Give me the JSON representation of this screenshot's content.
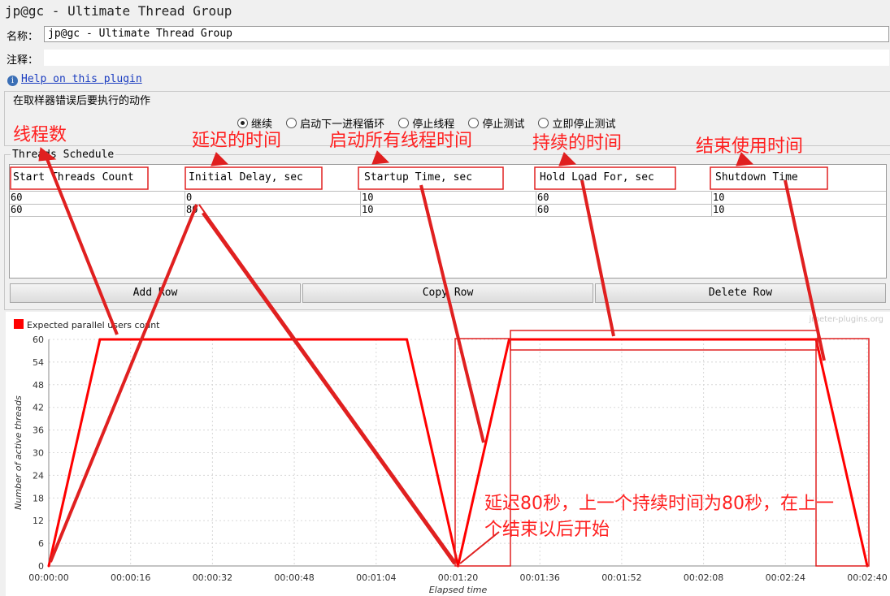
{
  "window": {
    "title": "jp@gc - Ultimate Thread Group"
  },
  "form": {
    "name_label": "名称：",
    "name_value": "jp@gc - Ultimate Thread Group",
    "comment_label": "注释：",
    "comment_value": "",
    "help_icon": "info-icon",
    "help_text": "Help on this plugin"
  },
  "error_action": {
    "title": "在取样器错误后要执行的动作",
    "options": [
      {
        "label": "继续",
        "selected": true
      },
      {
        "label": "启动下一进程循环",
        "selected": false
      },
      {
        "label": "停止线程",
        "selected": false
      },
      {
        "label": "停止测试",
        "selected": false
      },
      {
        "label": "立即停止测试",
        "selected": false
      }
    ]
  },
  "schedule": {
    "title": "Threads Schedule",
    "columns": [
      "Start Threads Count",
      "Initial Delay, sec",
      "Startup Time, sec",
      "Hold Load For, sec",
      "Shutdown Time"
    ],
    "rows": [
      [
        "60",
        "0",
        "10",
        "60",
        "10"
      ],
      [
        "60",
        "80",
        "10",
        "60",
        "10"
      ]
    ],
    "buttons": {
      "add": "Add Row",
      "copy": "Copy Row",
      "delete": "Delete Row"
    }
  },
  "annotations": {
    "threads": "线程数",
    "delay": "延迟的时间",
    "startup": "启动所有线程时间",
    "hold": "持续的时间",
    "shutdown": "结束使用时间",
    "note_line1": "延迟80秒，上一个持续时间为80秒，在上一",
    "note_line2": "个结束以后开始",
    "color": "#ff2020"
  },
  "chart_data": {
    "type": "line",
    "legend": "Expected parallel users count",
    "legend_position": "top-left",
    "watermark": "jmeter-plugins.org",
    "series_color": "#ff0000",
    "xlabel": "Elapsed time",
    "ylabel": "Number of active threads",
    "ylim": [
      0,
      60
    ],
    "xlim": [
      0,
      160
    ],
    "grid": true,
    "y_ticks": [
      "0",
      "6",
      "12",
      "18",
      "24",
      "30",
      "36",
      "42",
      "48",
      "54",
      "60"
    ],
    "x_ticks": [
      "00:00:00",
      "00:00:16",
      "00:00:32",
      "00:00:48",
      "00:01:04",
      "00:01:20",
      "00:01:36",
      "00:01:52",
      "00:02:08",
      "00:02:24",
      "00:02:40"
    ],
    "series": [
      {
        "x": [
          0,
          10,
          70,
          80,
          80,
          90,
          150,
          160
        ],
        "y": [
          0,
          60,
          60,
          0,
          0,
          60,
          60,
          0
        ]
      }
    ]
  }
}
